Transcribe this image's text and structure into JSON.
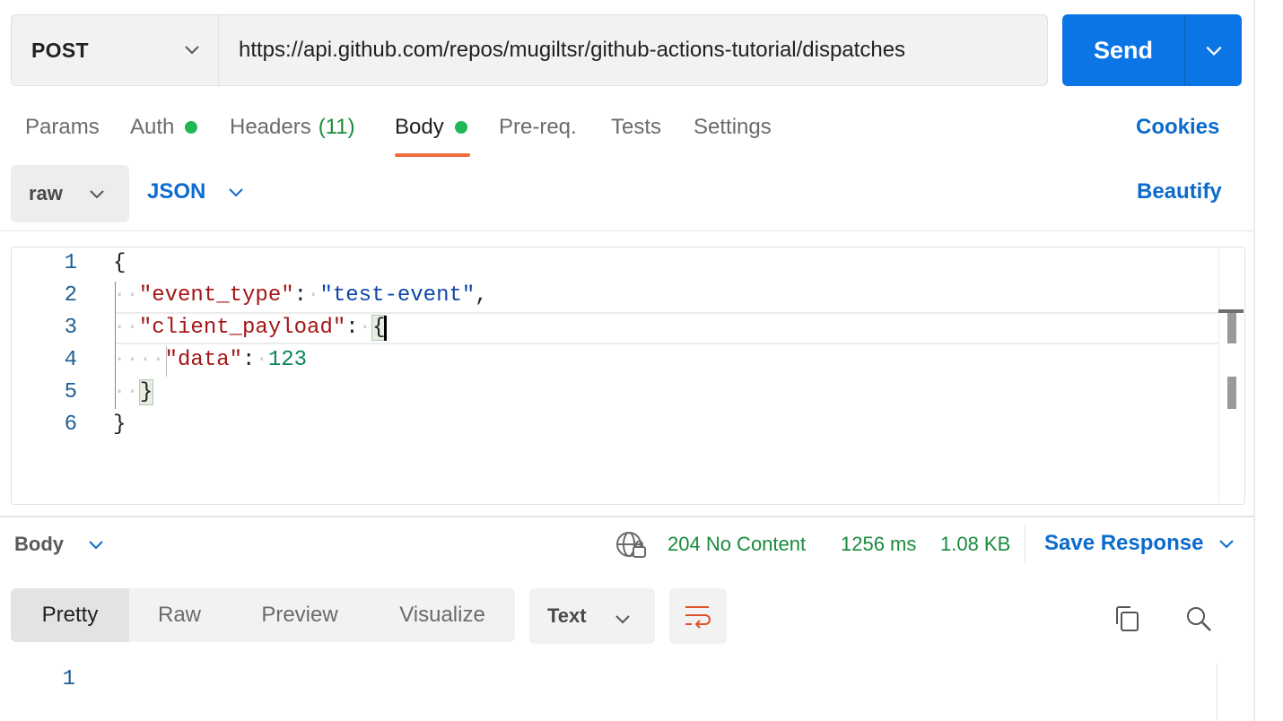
{
  "request": {
    "method": "POST",
    "url": "https://api.github.com/repos/mugiltsr/github-actions-tutorial/dispatches",
    "send_label": "Send"
  },
  "tabs": [
    {
      "label": "Params"
    },
    {
      "label": "Auth"
    },
    {
      "label": "Headers",
      "count": "(11)"
    },
    {
      "label": "Body"
    },
    {
      "label": "Pre-req."
    },
    {
      "label": "Tests"
    },
    {
      "label": "Settings"
    }
  ],
  "active_tab": "Body",
  "cookies_label": "Cookies",
  "body_options": {
    "mode": "raw",
    "language": "JSON",
    "beautify_label": "Beautify"
  },
  "editor": {
    "line_numbers": [
      "1",
      "2",
      "3",
      "4",
      "5",
      "6"
    ],
    "lines": {
      "l1_brace": "{",
      "l2_key": "\"event_type\"",
      "l2_colon": ":",
      "l2_value": "\"test-event\"",
      "l2_comma": ",",
      "l3_key": "\"client_payload\"",
      "l3_colon": ":",
      "l3_brace": "{",
      "l4_key": "\"data\"",
      "l4_colon": ":",
      "l4_value": "123",
      "l5_brace": "}",
      "l6_brace": "}"
    }
  },
  "response": {
    "body_label": "Body",
    "status": "204 No Content",
    "time": "1256 ms",
    "size": "1.08 KB",
    "save_label": "Save Response",
    "views": [
      "Pretty",
      "Raw",
      "Preview",
      "Visualize"
    ],
    "active_view": "Pretty",
    "format": "Text",
    "line_numbers": [
      "1"
    ]
  },
  "colors": {
    "accent_blue": "#0c75e5",
    "link_blue": "#0c6bcc",
    "status_green": "#1a8b3e",
    "dot_green": "#1fb855",
    "tab_underline": "#f26b3a"
  }
}
